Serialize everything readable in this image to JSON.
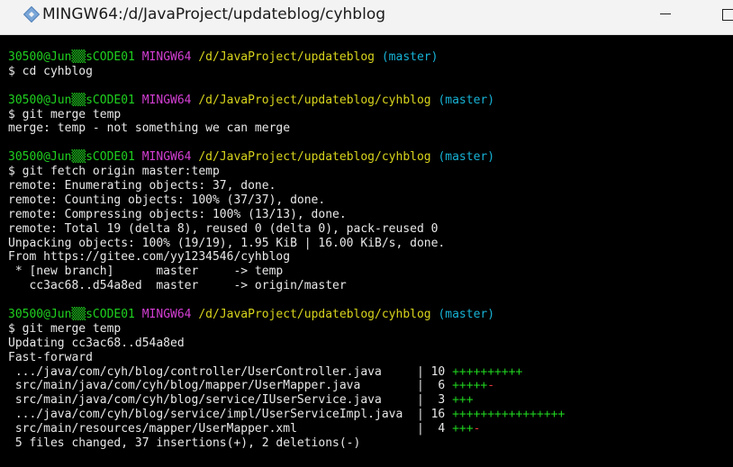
{
  "window": {
    "title": "MINGW64:/d/JavaProject/updateblog/cyhblog",
    "app_icon": "git-diamond-icon",
    "controls": [
      "minimize-icon",
      "maximize-icon"
    ]
  },
  "colors": {
    "prompt_user": "#1fd11f",
    "prompt_shell": "#d43fd4",
    "prompt_path": "#d8d41c",
    "prompt_branch": "#17b3d6",
    "diff_plus": "#1fd11f",
    "diff_minus": "#e8383f",
    "background": "#000000",
    "text": "#e8e8e8"
  },
  "prompt": {
    "user": "30500@Jun▒▒sCODE01",
    "shell": "MINGW64",
    "branch": "(master)"
  },
  "blocks": [
    {
      "path": "/d/JavaProject/updateblog",
      "command": "$ cd cyhblog",
      "output": []
    },
    {
      "path": "/d/JavaProject/updateblog/cyhblog",
      "command": "$ git merge temp",
      "output": [
        "merge: temp - not something we can merge"
      ]
    },
    {
      "path": "/d/JavaProject/updateblog/cyhblog",
      "command": "$ git fetch origin master:temp",
      "output": [
        "remote: Enumerating objects: 37, done.",
        "remote: Counting objects: 100% (37/37), done.",
        "remote: Compressing objects: 100% (13/13), done.",
        "remote: Total 19 (delta 8), reused 0 (delta 0), pack-reused 0",
        "Unpacking objects: 100% (19/19), 1.95 KiB | 16.00 KiB/s, done.",
        "From https://gitee.com/yy1234546/cyhblog",
        " * [new branch]      master     -> temp",
        "   cc3ac68..d54a8ed  master     -> origin/master"
      ]
    },
    {
      "path": "/d/JavaProject/updateblog/cyhblog",
      "command": "$ git merge temp",
      "output": [
        "Updating cc3ac68..d54a8ed",
        "Fast-forward"
      ]
    }
  ],
  "diffstat": [
    {
      "file": " .../java/com/cyh/blog/controller/UserController.java     ",
      "sep": "| ",
      "count": "10",
      "plus": "++++++++++",
      "minus": ""
    },
    {
      "file": " src/main/java/com/cyh/blog/mapper/UserMapper.java        ",
      "sep": "| ",
      "count": " 6",
      "plus": "+++++",
      "minus": "-"
    },
    {
      "file": " src/main/java/com/cyh/blog/service/IUserService.java     ",
      "sep": "| ",
      "count": " 3",
      "plus": "+++",
      "minus": ""
    },
    {
      "file": " .../java/com/cyh/blog/service/impl/UserServiceImpl.java  ",
      "sep": "| ",
      "count": "16",
      "plus": "++++++++++++++++",
      "minus": ""
    },
    {
      "file": " src/main/resources/mapper/UserMapper.xml                 ",
      "sep": "| ",
      "count": " 4",
      "plus": "+++",
      "minus": "-"
    }
  ],
  "summary": " 5 files changed, 37 insertions(+), 2 deletions(-)"
}
